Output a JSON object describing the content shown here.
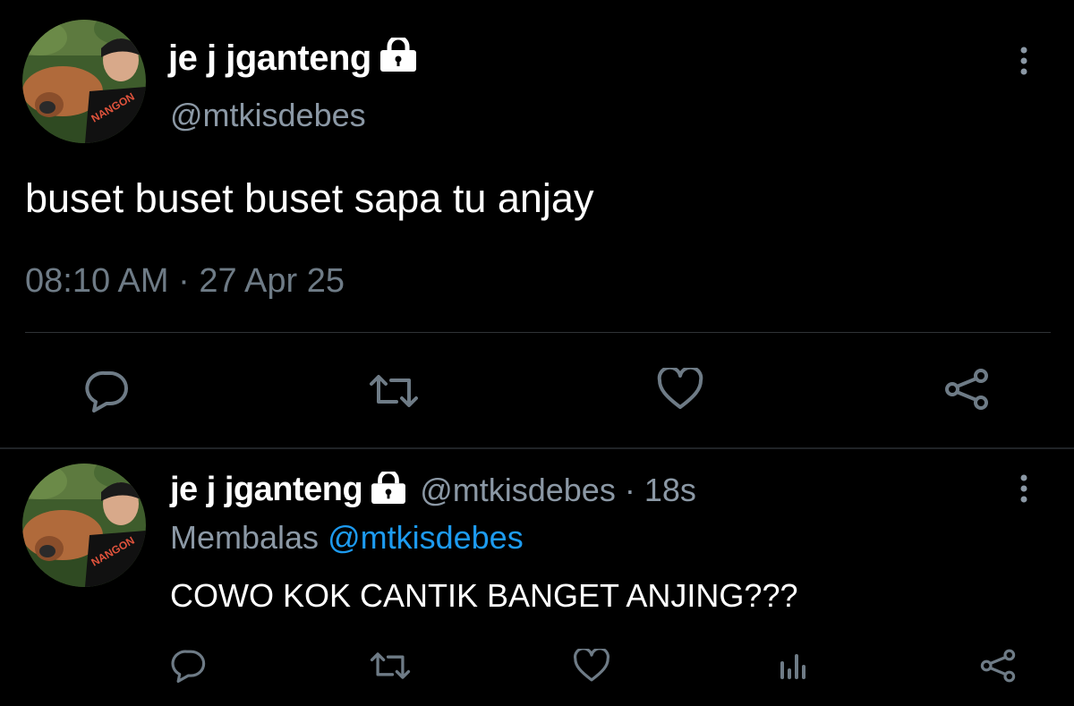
{
  "main_tweet": {
    "display_name": "je j jganteng",
    "handle": "@mtkisdebes",
    "text": "buset buset buset sapa tu anjay",
    "timestamp": "08:10 AM · 27 Apr 25",
    "avatar_shirt_text": "NANGON",
    "icons": [
      "lock-icon",
      "more-icon",
      "reply-icon",
      "retweet-icon",
      "like-icon",
      "share-icon"
    ]
  },
  "reply_tweet": {
    "display_name": "je j jganteng",
    "handle_time": "@mtkisdebes · 18s",
    "replying_prefix": "Membalas",
    "replying_to": "@mtkisdebes",
    "text": "COWO KOK CANTIK BANGET ANJING???",
    "avatar_shirt_text": "NANGON",
    "icons": [
      "lock-icon",
      "more-icon",
      "reply-icon",
      "retweet-icon",
      "like-icon",
      "analytics-icon",
      "share-icon"
    ]
  },
  "colors": {
    "background": "#000000",
    "primary_text": "#ffffff",
    "secondary_text": "#8b98a5",
    "link": "#1d9bf0",
    "divider": "#2f3336",
    "icon": "#6e7b86"
  }
}
